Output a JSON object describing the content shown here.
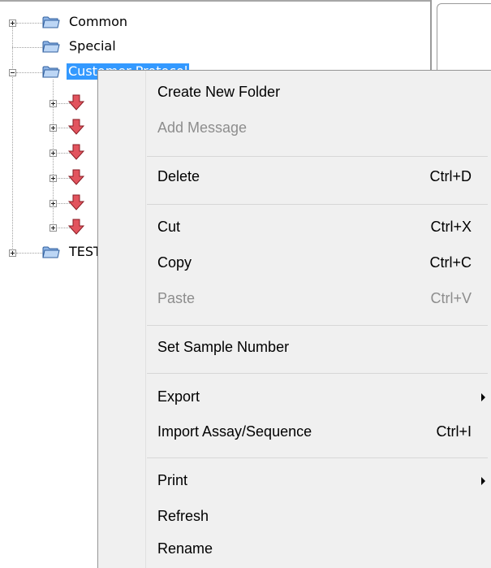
{
  "tree": {
    "nodes": [
      {
        "label": "Common"
      },
      {
        "label": "Special"
      },
      {
        "label": "Customer Protocol"
      },
      {
        "label": "TEST"
      }
    ]
  },
  "context_menu": {
    "items": [
      {
        "label": "Create New Folder",
        "shortcut": ""
      },
      {
        "label": "Add Message",
        "shortcut": ""
      },
      {
        "label": "Delete",
        "shortcut": "Ctrl+D"
      },
      {
        "label": "Cut",
        "shortcut": "Ctrl+X"
      },
      {
        "label": "Copy",
        "shortcut": "Ctrl+C"
      },
      {
        "label": "Paste",
        "shortcut": "Ctrl+V"
      },
      {
        "label": "Set Sample Number",
        "shortcut": ""
      },
      {
        "label": "Export",
        "shortcut": ""
      },
      {
        "label": "Import Assay/Sequence",
        "shortcut": "Ctrl+I"
      },
      {
        "label": "Print",
        "shortcut": ""
      },
      {
        "label": "Refresh",
        "shortcut": ""
      },
      {
        "label": "Rename",
        "shortcut": ""
      }
    ]
  },
  "colors": {
    "selection": "#3399ff",
    "folder_fill": "#a9c8ee",
    "arrow_fill": "#e2545e",
    "menu_background": "#f0f0f0",
    "disabled_text": "#8d8d8d"
  }
}
